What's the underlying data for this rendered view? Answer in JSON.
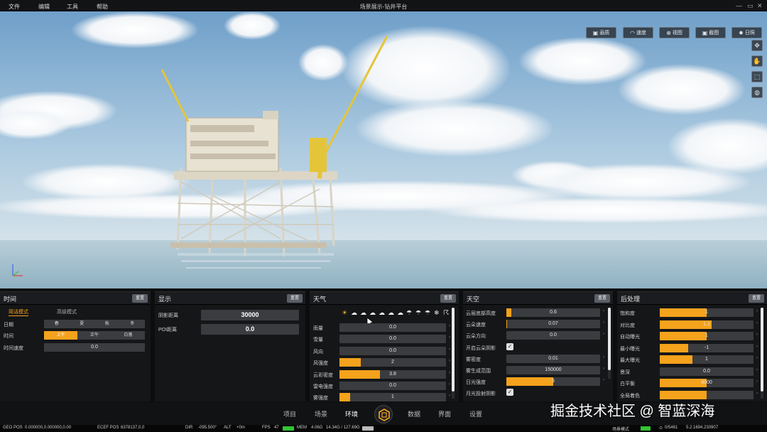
{
  "menu": {
    "file": "文件",
    "edit": "编辑",
    "tools": "工具",
    "help": "帮助"
  },
  "app_title": "场景展示-钻井平台",
  "view_buttons": [
    {
      "label": "画质",
      "icon": "image-icon"
    },
    {
      "label": "速度",
      "icon": "speed-icon"
    },
    {
      "label": "视图",
      "icon": "view-icon"
    },
    {
      "label": "截图",
      "icon": "screenshot-icon"
    },
    {
      "label": "日照",
      "icon": "sun-icon"
    }
  ],
  "tools": [
    "move-icon",
    "pan-icon",
    "navigate-icon",
    "globe-icon"
  ],
  "time_panel": {
    "title": "时间",
    "reset": "重置",
    "tabs": [
      "简洁模式",
      "高级模式"
    ],
    "date": {
      "label": "日期",
      "options": [
        "春",
        "夏",
        "秋",
        "冬"
      ],
      "selected": 0
    },
    "time": {
      "label": "时间",
      "options": [
        "上午",
        "正午",
        "白落"
      ],
      "selected": 0
    },
    "speed": {
      "label": "时间速度",
      "value": "0.0"
    }
  },
  "display_panel": {
    "title": "显示",
    "reset": "重置",
    "rows": [
      {
        "label": "阴影距离",
        "value": "30000"
      },
      {
        "label": "POI距离",
        "value": "0.0"
      }
    ]
  },
  "weather_panel": {
    "title": "天气",
    "reset": "重置",
    "icons": [
      "sunny-icon",
      "partly-cloudy-icon",
      "cloudy-icon",
      "overcast-icon",
      "cloud-icon",
      "cloud-icon",
      "rain-cloud-icon",
      "light-rain-icon",
      "rain-icon",
      "heavy-rain-icon",
      "snow-icon",
      "storm-icon"
    ],
    "rows": [
      {
        "label": "雨量",
        "value": "0.0",
        "fill": 0
      },
      {
        "label": "雪量",
        "value": "0.0",
        "fill": 0
      },
      {
        "label": "风向",
        "value": "0.0",
        "fill": 0
      },
      {
        "label": "风强度",
        "value": "2",
        "fill": 0.2
      },
      {
        "label": "云彩密度",
        "value": "3.8",
        "fill": 0.38
      },
      {
        "label": "雷电强度",
        "value": "0.0",
        "fill": 0
      },
      {
        "label": "雾强度",
        "value": "1",
        "fill": 0.1
      }
    ]
  },
  "sky_panel": {
    "title": "天空",
    "reset": "重置",
    "rows": [
      {
        "label": "云层底部高度",
        "value": "0.6",
        "fill": 0.05,
        "type": "slider"
      },
      {
        "label": "云朵速度",
        "value": "0.07",
        "fill": 0.01,
        "type": "slider"
      },
      {
        "label": "云朵方向",
        "value": "0.0",
        "fill": 0,
        "type": "slider"
      },
      {
        "label": "开启云朵阴影",
        "type": "check"
      },
      {
        "label": "雾密度",
        "value": "0.01",
        "fill": 0,
        "type": "slider"
      },
      {
        "label": "雾生成范围",
        "value": "150000",
        "fill": 0,
        "type": "slider"
      },
      {
        "label": "日光强度",
        "value": "5",
        "fill": 0.5,
        "type": "slider"
      },
      {
        "label": "月光投射阴影",
        "type": "check"
      }
    ]
  },
  "post_panel": {
    "title": "后处理",
    "reset": "重置",
    "rows": [
      {
        "label": "饱和度",
        "value": "1",
        "fill": 0.5
      },
      {
        "label": "对比度",
        "value": "1.1",
        "fill": 0.55
      },
      {
        "label": "自动曝光",
        "value": "1",
        "fill": 0.5
      },
      {
        "label": "最小曝光",
        "value": "-1",
        "fill": 0.3
      },
      {
        "label": "最大曝光",
        "value": "1",
        "fill": 0.35
      },
      {
        "label": "景深",
        "value": "0.0",
        "fill": 0
      },
      {
        "label": "白平衡",
        "value": "6000",
        "fill": 0.5
      },
      {
        "label": "全局着色",
        "value": "",
        "fill": 0.5
      }
    ]
  },
  "bottom_nav": [
    "项目",
    "场景",
    "环境",
    "数据",
    "界面",
    "设置"
  ],
  "status": {
    "geo_label": "GEO POS",
    "geo": "0.000000,0.000000,0.00",
    "ecef_label": "ECEF POS",
    "ecef": "6378137,0,0",
    "dir_label": "DIR",
    "dir": "-095.500°",
    "alt_label": "ALT",
    "alt": "+0m",
    "fps_label": "FPS",
    "fps": "47",
    "mem_label": "MEM",
    "mem": "4.06G",
    "mem2": "14.34G / 127.69G",
    "mode": "场景模式",
    "count": "0/5461",
    "version": "5.2.1694.230907"
  },
  "watermark": "掘金技术社区 @ 智蓝深海"
}
